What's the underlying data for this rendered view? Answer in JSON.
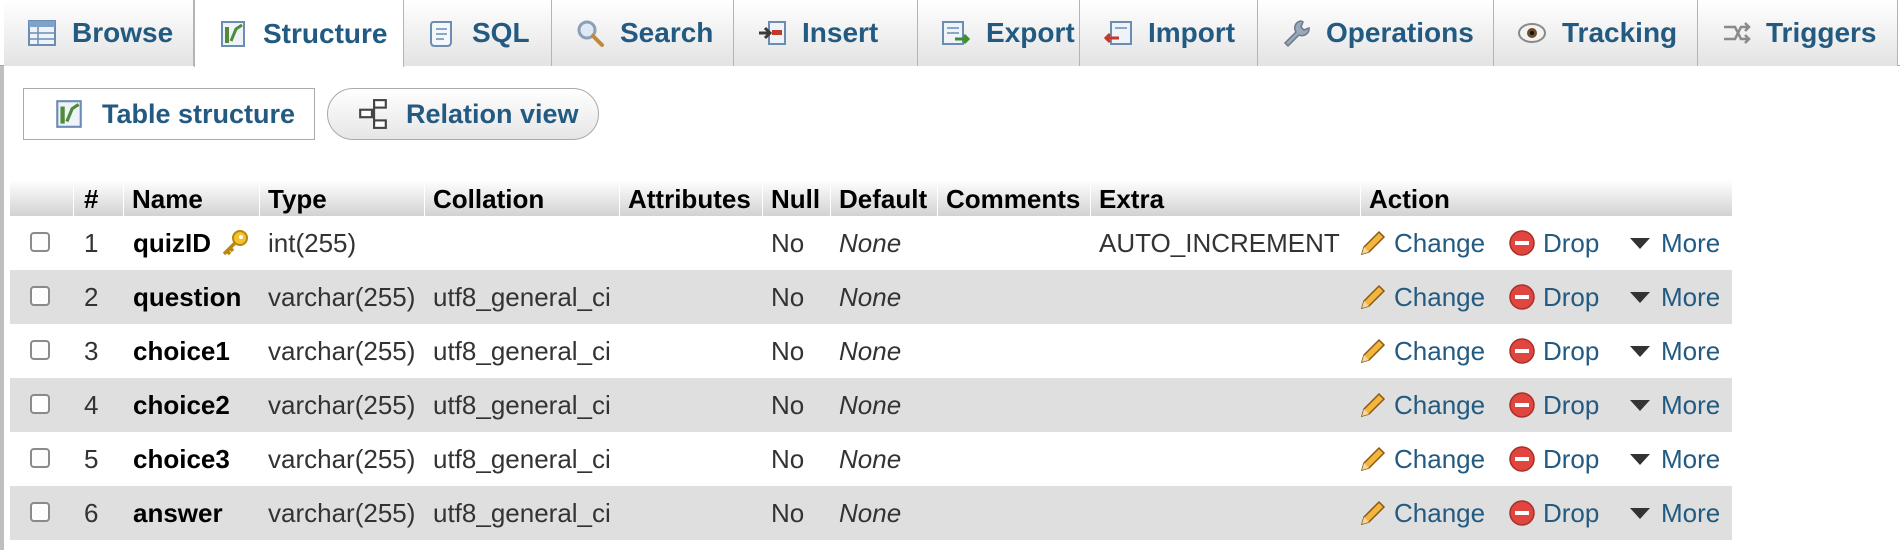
{
  "tabs": [
    {
      "label": "Browse",
      "icon": "browse-table-icon",
      "active": false
    },
    {
      "label": "Structure",
      "icon": "structure-icon",
      "active": true
    },
    {
      "label": "SQL",
      "icon": "sql-scroll-icon",
      "active": false
    },
    {
      "label": "Search",
      "icon": "search-icon",
      "active": false
    },
    {
      "label": "Insert",
      "icon": "insert-icon",
      "active": false
    },
    {
      "label": "Export",
      "icon": "export-icon",
      "active": false
    },
    {
      "label": "Import",
      "icon": "import-icon",
      "active": false
    },
    {
      "label": "Operations",
      "icon": "wrench-icon",
      "active": false
    },
    {
      "label": "Tracking",
      "icon": "eye-icon",
      "active": false
    },
    {
      "label": "Triggers",
      "icon": "triggers-icon",
      "active": false
    }
  ],
  "subtabs": [
    {
      "label": "Table structure",
      "icon": "structure-icon"
    },
    {
      "label": "Relation view",
      "icon": "relation-view-icon"
    }
  ],
  "table": {
    "headers": {
      "num": "#",
      "name": "Name",
      "type": "Type",
      "collation": "Collation",
      "attributes": "Attributes",
      "null": "Null",
      "default": "Default",
      "comments": "Comments",
      "extra": "Extra",
      "action": "Action"
    },
    "rows": [
      {
        "num": "1",
        "name": "quizID",
        "primary_key": true,
        "type": "int(255)",
        "collation": "",
        "null": "No",
        "default": "None",
        "extra": "AUTO_INCREMENT"
      },
      {
        "num": "2",
        "name": "question",
        "primary_key": false,
        "type": "varchar(255)",
        "collation": "utf8_general_ci",
        "null": "No",
        "default": "None",
        "extra": ""
      },
      {
        "num": "3",
        "name": "choice1",
        "primary_key": false,
        "type": "varchar(255)",
        "collation": "utf8_general_ci",
        "null": "No",
        "default": "None",
        "extra": ""
      },
      {
        "num": "4",
        "name": "choice2",
        "primary_key": false,
        "type": "varchar(255)",
        "collation": "utf8_general_ci",
        "null": "No",
        "default": "None",
        "extra": ""
      },
      {
        "num": "5",
        "name": "choice3",
        "primary_key": false,
        "type": "varchar(255)",
        "collation": "utf8_general_ci",
        "null": "No",
        "default": "None",
        "extra": ""
      },
      {
        "num": "6",
        "name": "answer",
        "primary_key": false,
        "type": "varchar(255)",
        "collation": "utf8_general_ci",
        "null": "No",
        "default": "None",
        "extra": ""
      }
    ],
    "actions": {
      "change": "Change",
      "drop": "Drop",
      "more": "More"
    }
  },
  "colors": {
    "link": "#235a81",
    "row_alt": "#dfdfdf",
    "drop_icon": "#e0463f",
    "pencil": "#e6a52e"
  }
}
